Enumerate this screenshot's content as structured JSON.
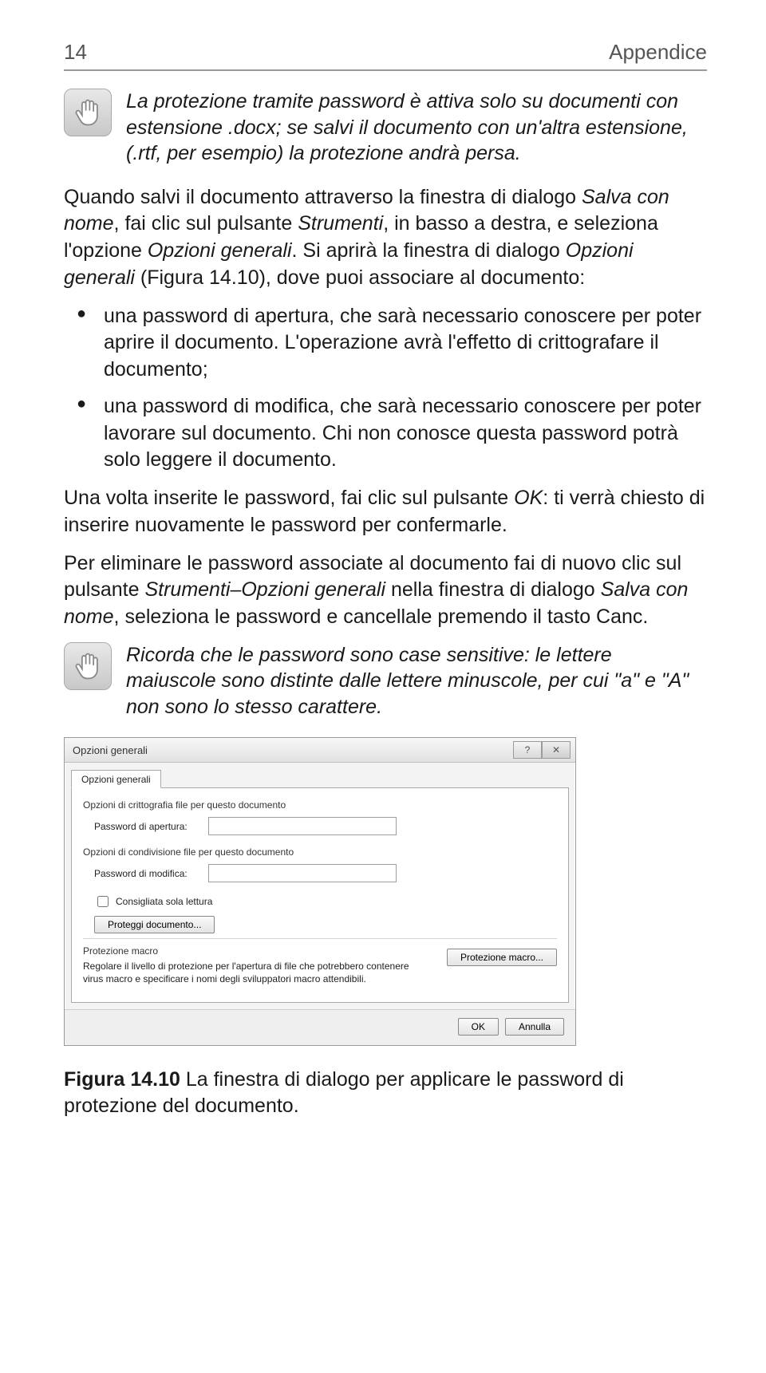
{
  "header": {
    "page_num": "14",
    "section": "Appendice"
  },
  "note1": "La protezione tramite password è attiva solo su documenti con estensione .docx; se salvi il documento con un'altra estensione, (.rtf, per esempio) la protezione andrà persa.",
  "para1_a": "Quando salvi il documento attraverso la finestra di dialogo ",
  "para1_b": "Salva con nome",
  "para1_c": ", fai clic sul pulsante ",
  "para1_d": "Strumenti",
  "para1_e": ", in basso a destra, e seleziona l'opzione ",
  "para1_f": "Opzioni generali",
  "para1_g": ". Si aprirà la finestra di dialogo ",
  "para1_h": "Opzioni generali",
  "para1_i": " (Figura 14.10), dove puoi associare al documento:",
  "bullet1": "una password di apertura, che sarà necessario conoscere per poter aprire il documento. L'operazione avrà l'effetto di crittografare il documento;",
  "bullet2": "una password di modifica, che sarà necessario conoscere per poter lavorare sul documento. Chi non conosce questa password potrà solo leggere il documento.",
  "para2_a": "Una volta inserite le password, fai clic sul pulsante ",
  "para2_b": "OK",
  "para2_c": ": ti verrà chiesto di inserire nuovamente le password per confermarle.",
  "para3_a": "Per eliminare le password associate al documento fai di nuovo clic sul pulsante ",
  "para3_b": "Strumenti–Opzioni generali",
  "para3_c": " nella finestra di dialogo ",
  "para3_d": "Salva con nome",
  "para3_e": ", seleziona le password e cancellale premendo il tasto Canc.",
  "note2": "Ricorda che le password sono case sensitive: le lettere maiuscole sono distinte dalle lettere minuscole, per cui \"a\" e \"A\" non sono lo stesso carattere.",
  "dialog": {
    "title": "Opzioni generali",
    "tab": "Opzioni generali",
    "group1": "Opzioni di crittografia file per questo documento",
    "pw_open_label": "Password di apertura:",
    "group2": "Opzioni di condivisione file per questo documento",
    "pw_mod_label": "Password di modifica:",
    "readonly_label": "Consigliata sola lettura",
    "protect_btn": "Proteggi documento...",
    "macro_header": "Protezione macro",
    "macro_desc": "Regolare il livello di protezione per l'apertura di file che potrebbero contenere virus macro e specificare i nomi degli sviluppatori macro attendibili.",
    "macro_btn": "Protezione macro...",
    "ok": "OK",
    "cancel": "Annulla"
  },
  "caption_strong": "Figura 14.10",
  "caption_text": "   La finestra di dialogo per applicare le password di protezione del documento."
}
